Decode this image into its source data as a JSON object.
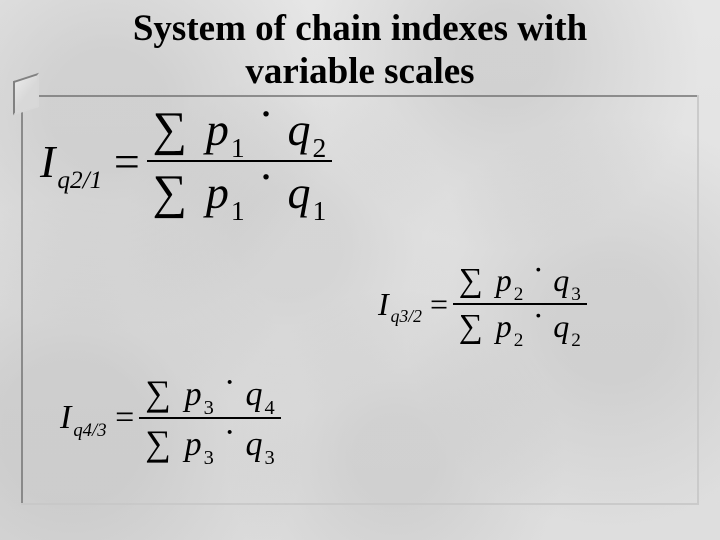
{
  "title_line1": "System of chain indexes with",
  "title_line2": "variable scales",
  "eq1": {
    "I": "I",
    "sub": "q2/1",
    "eq": "=",
    "sig": "∑",
    "p": "p",
    "q": "q",
    "dot": "·",
    "n_p_sub": "1",
    "n_q_sub": "2",
    "d_p_sub": "1",
    "d_q_sub": "1"
  },
  "eq2": {
    "I": "I",
    "sub": "q3/2",
    "eq": "=",
    "sig": "∑",
    "p": "p",
    "q": "q",
    "dot": "·",
    "n_p_sub": "2",
    "n_q_sub": "3",
    "d_p_sub": "2",
    "d_q_sub": "2"
  },
  "eq3": {
    "I": "I",
    "sub": "q4/3",
    "eq": "=",
    "sig": "∑",
    "p": "p",
    "q": "q",
    "dot": "·",
    "n_p_sub": "3",
    "n_q_sub": "4",
    "d_p_sub": "3",
    "d_q_sub": "3"
  }
}
